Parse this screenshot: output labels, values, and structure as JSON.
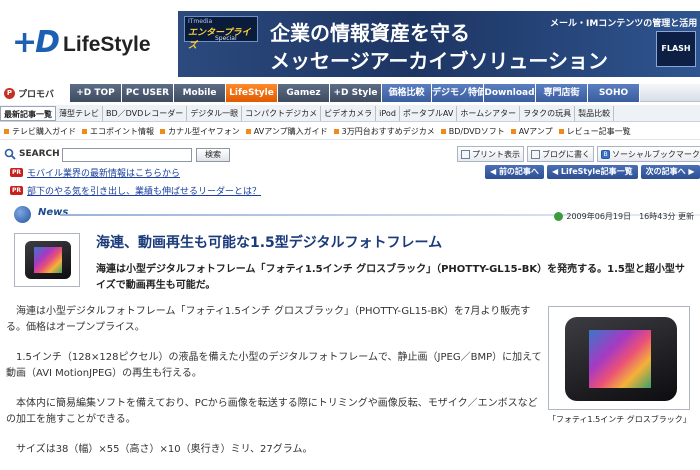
{
  "logo": {
    "mark": "+D",
    "name": "LifeStyle"
  },
  "ad": {
    "badge_top": "ITmedia",
    "badge_main": "エンタープライズ",
    "badge_sub": "Special",
    "line1": "企業の情報資産を守る",
    "line2": "メッセージアーカイブソリューション",
    "sub": "メール・IMコンテンツの管理と活用",
    "flash": "FLASH"
  },
  "promo": {
    "icon": "P",
    "label": "プロモバ"
  },
  "tabs": [
    {
      "label": "+D TOP",
      "style": "dark",
      "width": 52
    },
    {
      "label": "PC USER",
      "style": "dark",
      "width": 52
    },
    {
      "label": "Mobile",
      "style": "dark",
      "width": 52
    },
    {
      "label": "LifeStyle",
      "style": "active",
      "width": 52
    },
    {
      "label": "Gamez",
      "style": "dark",
      "width": 52
    },
    {
      "label": "+D Style",
      "style": "dark",
      "width": 52
    },
    {
      "label": "価格比較",
      "style": "blue",
      "width": 50
    },
    {
      "label": "デジモノ特価",
      "style": "blue",
      "width": 52
    },
    {
      "label": "Download",
      "style": "blue",
      "width": 52
    },
    {
      "label": "専門店街",
      "style": "blue",
      "width": 52
    },
    {
      "label": "SOHO",
      "style": "blue",
      "width": 52
    }
  ],
  "subnav": [
    "最新記事一覧",
    "薄型テレビ",
    "BD／DVDレコーダー",
    "デジタル一眼",
    "コンパクトデジカメ",
    "ビデオカメラ",
    "iPod",
    "ポータブルAV",
    "ホームシアター",
    "ヲタクの玩具",
    "製品比較"
  ],
  "subnav_current": 0,
  "links": [
    "テレビ購入ガイド",
    "エコポイント情報",
    "カナル型イヤフォン",
    "AVアンプ購入ガイド",
    "3万円台おすすめデジカメ",
    "BD/DVDソフト",
    "AVアンプ",
    "レビュー記事一覧"
  ],
  "search": {
    "label": "SEARCH",
    "button": "検索",
    "value": ""
  },
  "tools": [
    {
      "label": "プリント表示",
      "icon": "print-icon",
      "glyph": ""
    },
    {
      "label": "ブログに書く",
      "icon": "blog-icon",
      "glyph": ""
    },
    {
      "label": "ソーシャルブックマーク",
      "icon": "bookmark-icon",
      "glyph": "B"
    }
  ],
  "pr": [
    {
      "badge": "PR",
      "text": "モバイル業界の最新情報はこちらから"
    },
    {
      "badge": "PR",
      "text": "部下のやる気を引き出し、業績も伸ばせるリーダーとは？"
    }
  ],
  "article_nav": [
    "◀ 前の記事へ",
    "◀ LifeStyle記事一覧",
    "次の記事へ ▶"
  ],
  "news_label": "News",
  "pubdate": "2009年06月19日　16時43分 更新",
  "headline": "海連、動画再生も可能な1.5型デジタルフォトフレーム",
  "lead": "海連は小型デジタルフォトフレーム「フォティ1.5インチ グロスブラック」（PHOTTY-GL15-BK）を発売する。1.5型と超小型サイズで動画再生も可能だ。",
  "paragraphs": [
    "海連は小型デジタルフォトフレーム「フォティ1.5インチ グロスブラック」（PHOTTY-GL15-BK）を7月より販売する。価格はオープンプライス。",
    "1.5インチ（128×128ピクセル）の液晶を備えた小型のデジタルフォトフレームで、静止画（JPEG／BMP）に加えて動画（AVI MotionJPEG）の再生も行える。",
    "本体内に簡易編集ソフトを備えており、PCから画像を転送する際にトリミングや画像反転、モザイク／エンボスなどの加工を施すことができる。",
    "サイズは38（幅）×55（高さ）×10（奥行き）ミリ、27グラム。"
  ],
  "caption": "「フォティ1.5インチ グロスブラック」"
}
